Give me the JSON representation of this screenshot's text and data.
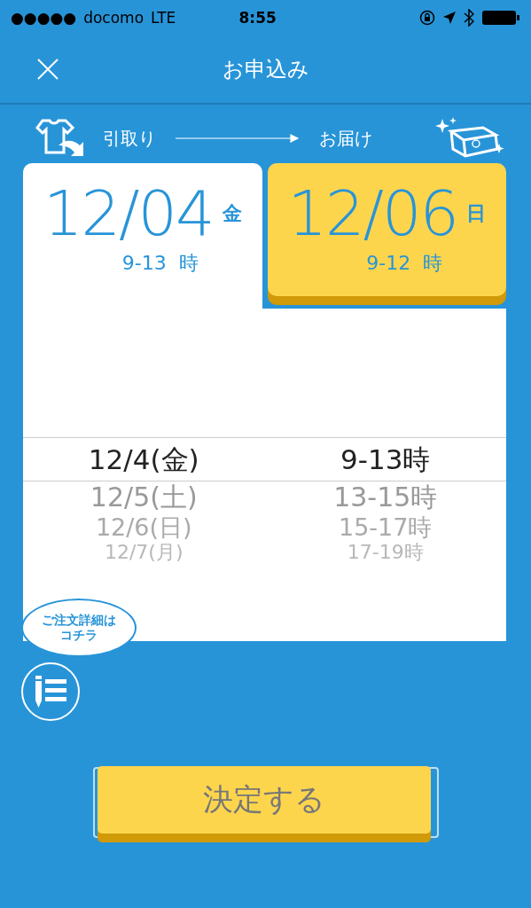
{
  "status_bar": {
    "signal": "●●●●●",
    "carrier": "docomo",
    "network": "LTE",
    "time": "8:55"
  },
  "nav": {
    "title": "お申込み"
  },
  "flow": {
    "from": "引取り",
    "to": "お届け"
  },
  "tabs": [
    {
      "date": "12/04",
      "weekday": "金",
      "hours": "9-13",
      "unit": "時",
      "selected": true
    },
    {
      "date": "12/06",
      "weekday": "日",
      "hours": "9-12",
      "unit": "時",
      "selected": false
    }
  ],
  "picker": {
    "columns": [
      {
        "options": [
          {
            "label": "12/4(金)",
            "selected": true
          },
          {
            "label": "12/5(土)",
            "selected": false
          },
          {
            "label": "12/6(日)",
            "selected": false
          },
          {
            "label": "12/7(月)",
            "selected": false
          }
        ]
      },
      {
        "options": [
          {
            "label": "9-13時",
            "selected": true
          },
          {
            "label": "13-15時",
            "selected": false
          },
          {
            "label": "15-17時",
            "selected": false
          },
          {
            "label": "17-19時",
            "selected": false
          }
        ]
      }
    ]
  },
  "order_details_bubble": [
    "ご注文詳細は",
    "コチラ"
  ],
  "submit_button": "決定する"
}
